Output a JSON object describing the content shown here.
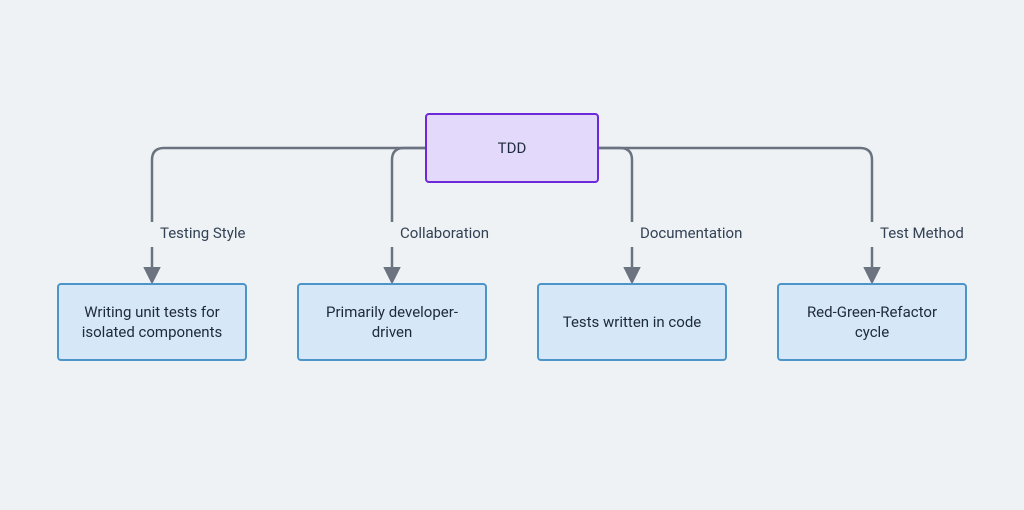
{
  "diagram": {
    "root": {
      "label": "TDD"
    },
    "children": [
      {
        "edge_label": "Testing Style",
        "box_label": "Writing unit tests for isolated components"
      },
      {
        "edge_label": "Collaboration",
        "box_label": "Primarily developer-driven"
      },
      {
        "edge_label": "Documentation",
        "box_label": "Tests written in code"
      },
      {
        "edge_label": "Test Method",
        "box_label": "Red-Green-Refactor cycle"
      }
    ]
  },
  "colors": {
    "root_fill": "#e3d9fb",
    "root_border": "#6d28d9",
    "child_fill": "#d6e8f7",
    "child_border": "#4d94c9",
    "connector": "#6b7280",
    "background": "#eef2f5"
  },
  "chart_data": {
    "type": "tree",
    "root": "TDD",
    "edges": [
      {
        "from": "TDD",
        "label": "Testing Style",
        "to": "Writing unit tests for isolated components"
      },
      {
        "from": "TDD",
        "label": "Collaboration",
        "to": "Primarily developer-driven"
      },
      {
        "from": "TDD",
        "label": "Documentation",
        "to": "Tests written in code"
      },
      {
        "from": "TDD",
        "label": "Test Method",
        "to": "Red-Green-Refactor cycle"
      }
    ]
  }
}
